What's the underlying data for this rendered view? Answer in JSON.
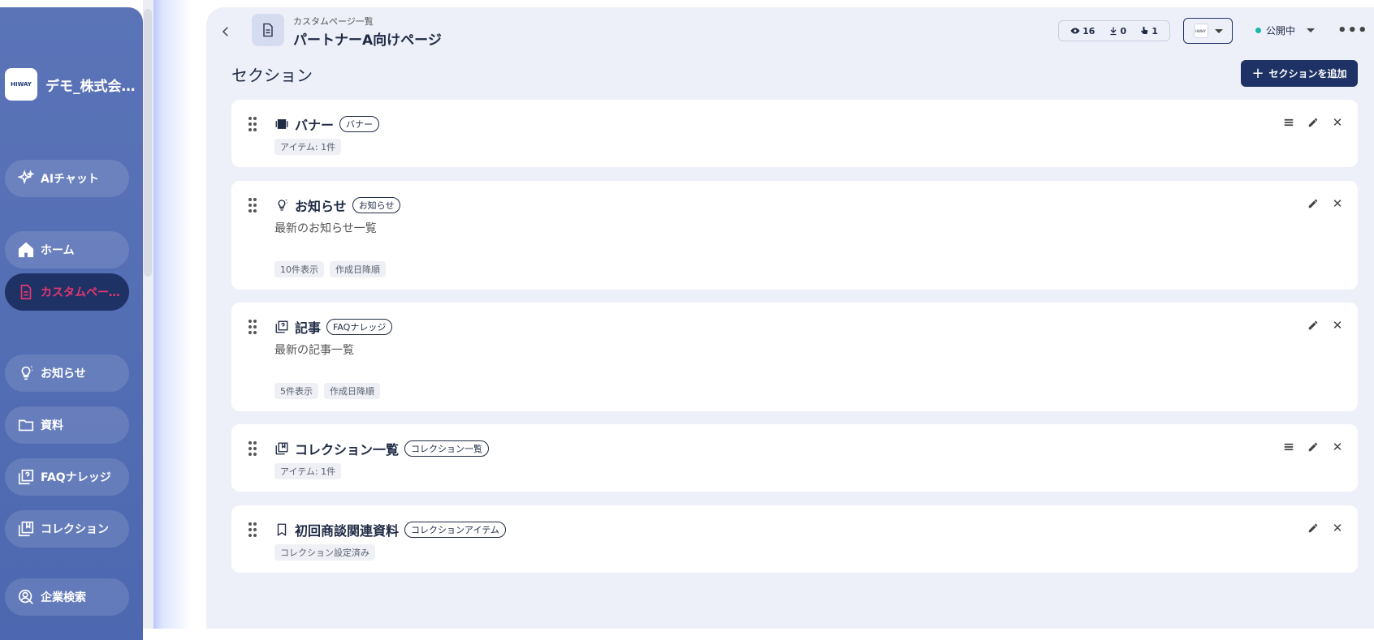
{
  "sidebar": {
    "brand_logo_text": "HIWAY",
    "brand_name": "デモ_株式会…",
    "items": [
      {
        "label": "AIチャット",
        "icon": "sparkle-icon"
      },
      {
        "label": "ホーム",
        "icon": "home-icon"
      },
      {
        "label": "カスタムページ…",
        "icon": "document-icon",
        "active": true
      },
      {
        "label": "お知らせ",
        "icon": "lightbulb-icon"
      },
      {
        "label": "資料",
        "icon": "folder-icon"
      },
      {
        "label": "FAQナレッジ",
        "icon": "faq-icon"
      },
      {
        "label": "コレクション",
        "icon": "collection-icon"
      },
      {
        "label": "企業検索",
        "icon": "company-search-icon"
      }
    ]
  },
  "header": {
    "breadcrumb": "カスタムページ一覧",
    "title": "パートナーA向けページ",
    "stats": {
      "views": "16",
      "downloads": "0",
      "clicks": "1"
    },
    "logo_select_text": "HIWAY",
    "status": "公開中"
  },
  "main": {
    "heading": "セクション",
    "add_button": "セクションを追加"
  },
  "sections": [
    {
      "title": "バナー",
      "type_label": "バナー",
      "icon": "banner-icon",
      "description": "",
      "tags": [
        "アイテム: 1件"
      ],
      "has_list_action": true
    },
    {
      "title": "お知らせ",
      "type_label": "お知らせ",
      "icon": "lightbulb-icon",
      "description": "最新のお知らせ一覧",
      "tags": [
        "10件表示",
        "作成日降順"
      ],
      "has_list_action": false
    },
    {
      "title": "記事",
      "type_label": "FAQナレッジ",
      "icon": "faq-icon",
      "description": "最新の記事一覧",
      "tags": [
        "5件表示",
        "作成日降順"
      ],
      "has_list_action": false
    },
    {
      "title": "コレクション一覧",
      "type_label": "コレクション一覧",
      "icon": "collection-icon",
      "description": "",
      "tags": [
        "アイテム: 1件"
      ],
      "has_list_action": true
    },
    {
      "title": "初回商談関連資料",
      "type_label": "コレクションアイテム",
      "icon": "bookmark-icon",
      "description": "",
      "tags": [
        "コレクション設定済み"
      ],
      "has_list_action": false
    }
  ],
  "colors": {
    "sidebar": "#5b74b8",
    "active_nav": "#1e3266",
    "active_text": "#e8366f",
    "status_dot": "#18b8a8"
  }
}
